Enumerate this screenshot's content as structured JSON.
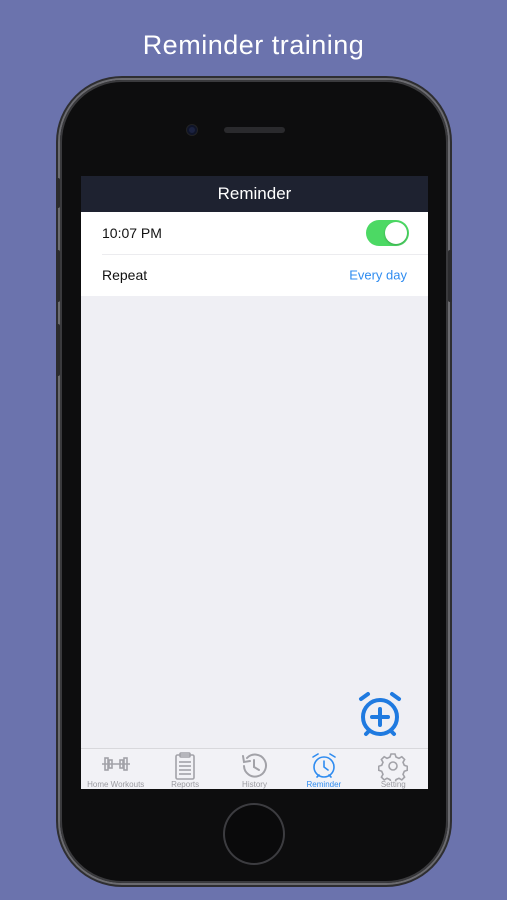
{
  "headline": "Reminder training",
  "navbar": {
    "title": "Reminder"
  },
  "reminder_list": {
    "time_row": {
      "label": "10:07 PM",
      "toggle_on": true
    },
    "repeat_row": {
      "label": "Repeat",
      "value": "Every day"
    }
  },
  "fab": {
    "icon": "add-alarm-icon"
  },
  "tabbar": {
    "active": "Reminder",
    "tabs": [
      {
        "label": "Home Workouts",
        "icon": "dumbbell-icon"
      },
      {
        "label": "Reports",
        "icon": "clipboard-icon"
      },
      {
        "label": "History",
        "icon": "history-icon"
      },
      {
        "label": "Reminder",
        "icon": "alarm-clock-icon"
      },
      {
        "label": "Setting",
        "icon": "gear-icon"
      }
    ]
  },
  "colors": {
    "background": "#6b73ad",
    "navbar": "#1e2230",
    "accent": "#2f8cf0",
    "toggle_on": "#4cd964",
    "tab_inactive": "#9a9aa0"
  }
}
